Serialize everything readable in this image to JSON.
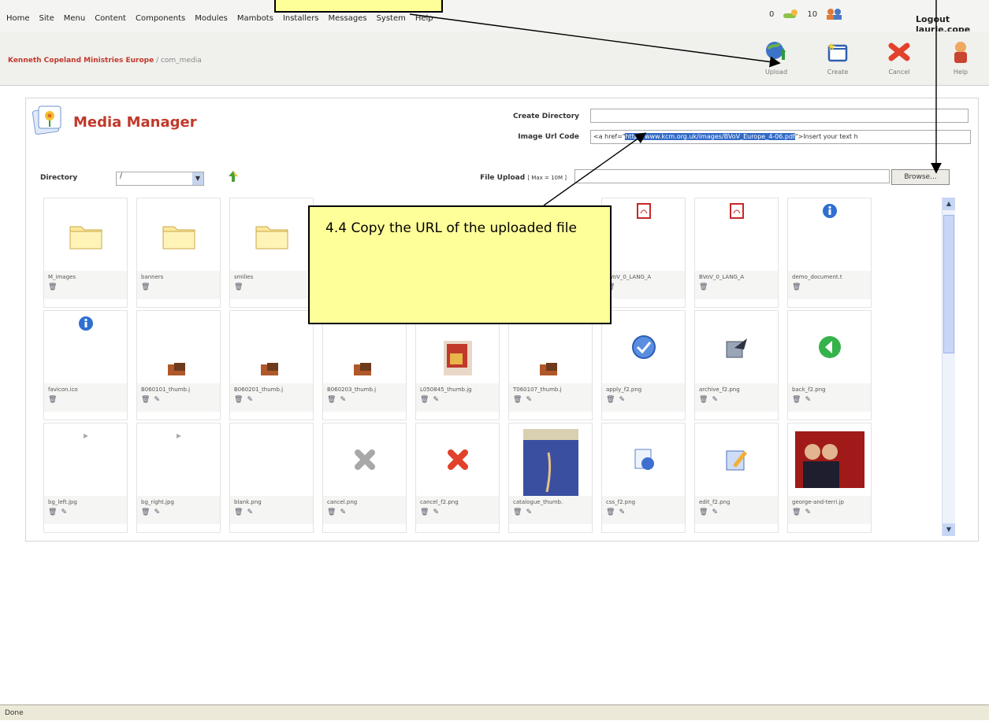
{
  "menu": [
    "Home",
    "Site",
    "Menu",
    "Content",
    "Components",
    "Modules",
    "Mambots",
    "Installers",
    "Messages",
    "System",
    "Help"
  ],
  "status_counts": {
    "messages": "0",
    "users": "10"
  },
  "logout_label": "Logout laurie.cope",
  "breadcrumb": {
    "site": "Kenneth Copeland Ministries Europe",
    "path": " / com_media"
  },
  "toolbar": [
    {
      "label": "Upload",
      "icon": "upload-icon"
    },
    {
      "label": "Create",
      "icon": "create-folder-icon"
    },
    {
      "label": "Cancel",
      "icon": "cancel-icon"
    },
    {
      "label": "Help",
      "icon": "help-icon"
    }
  ],
  "page_title": "Media Manager",
  "form": {
    "create_dir_label": "Create Directory",
    "create_dir_value": "",
    "image_url_label": "Image Url Code",
    "image_url_prefix": "<a href=\"",
    "image_url_selected": "http://www.kcm.org.uk/images/BVoV_Europe_4-06.pdf",
    "image_url_suffix": "\">Insert your text h",
    "directory_label": "Directory",
    "directory_value": "/",
    "file_upload_label": "File Upload",
    "file_upload_hint": "[ Max = 10M ]",
    "file_upload_value": "",
    "browse_label": "Browse..."
  },
  "files": [
    {
      "name": "M_images",
      "type": "folder",
      "edit": false
    },
    {
      "name": "banners",
      "type": "folder",
      "edit": false
    },
    {
      "name": "smilies",
      "type": "folder",
      "edit": false
    },
    {
      "name": "",
      "type": "hidden",
      "edit": false
    },
    {
      "name": "",
      "type": "hidden",
      "edit": false
    },
    {
      "name": "",
      "type": "hidden",
      "edit": false
    },
    {
      "name": "BVoV_0_LANG_A",
      "type": "pdf",
      "edit": false
    },
    {
      "name": "BVoV_0_LANG_A",
      "type": "pdf",
      "edit": false
    },
    {
      "name": "demo_document.t",
      "type": "info",
      "edit": false
    },
    {
      "name": "favicon.ico",
      "type": "info",
      "edit": false
    },
    {
      "name": "B060101_thumb.j",
      "type": "photo-small",
      "edit": true
    },
    {
      "name": "B060201_thumb.j",
      "type": "photo-small",
      "edit": true
    },
    {
      "name": "B060203_thumb.j",
      "type": "photo-small",
      "edit": true
    },
    {
      "name": "L050845_thumb.jg",
      "type": "photo-red",
      "edit": true
    },
    {
      "name": "T060107_thumb.j",
      "type": "photo-small",
      "edit": true
    },
    {
      "name": "apply_f2.png",
      "type": "apply",
      "edit": true
    },
    {
      "name": "archive_f2.png",
      "type": "archive",
      "edit": true
    },
    {
      "name": "back_f2.png",
      "type": "back",
      "edit": true
    },
    {
      "name": "bg_left.jpg",
      "type": "tiny",
      "edit": true
    },
    {
      "name": "bg_right.jpg",
      "type": "tiny",
      "edit": true
    },
    {
      "name": "blank.png",
      "type": "blank",
      "edit": true
    },
    {
      "name": "cancel.png",
      "type": "cancel-grey",
      "edit": true
    },
    {
      "name": "cancel_f2.png",
      "type": "cancel-red",
      "edit": true
    },
    {
      "name": "catalogue_thumb.",
      "type": "catalogue",
      "edit": true
    },
    {
      "name": "css_f2.png",
      "type": "css",
      "edit": true
    },
    {
      "name": "edit_f2.png",
      "type": "edit",
      "edit": true
    },
    {
      "name": "george-and-terri.jp",
      "type": "george",
      "edit": true
    }
  ],
  "callouts": {
    "copy_url": "4.4 Copy the URL of the uploaded file"
  },
  "status_text": "Done"
}
